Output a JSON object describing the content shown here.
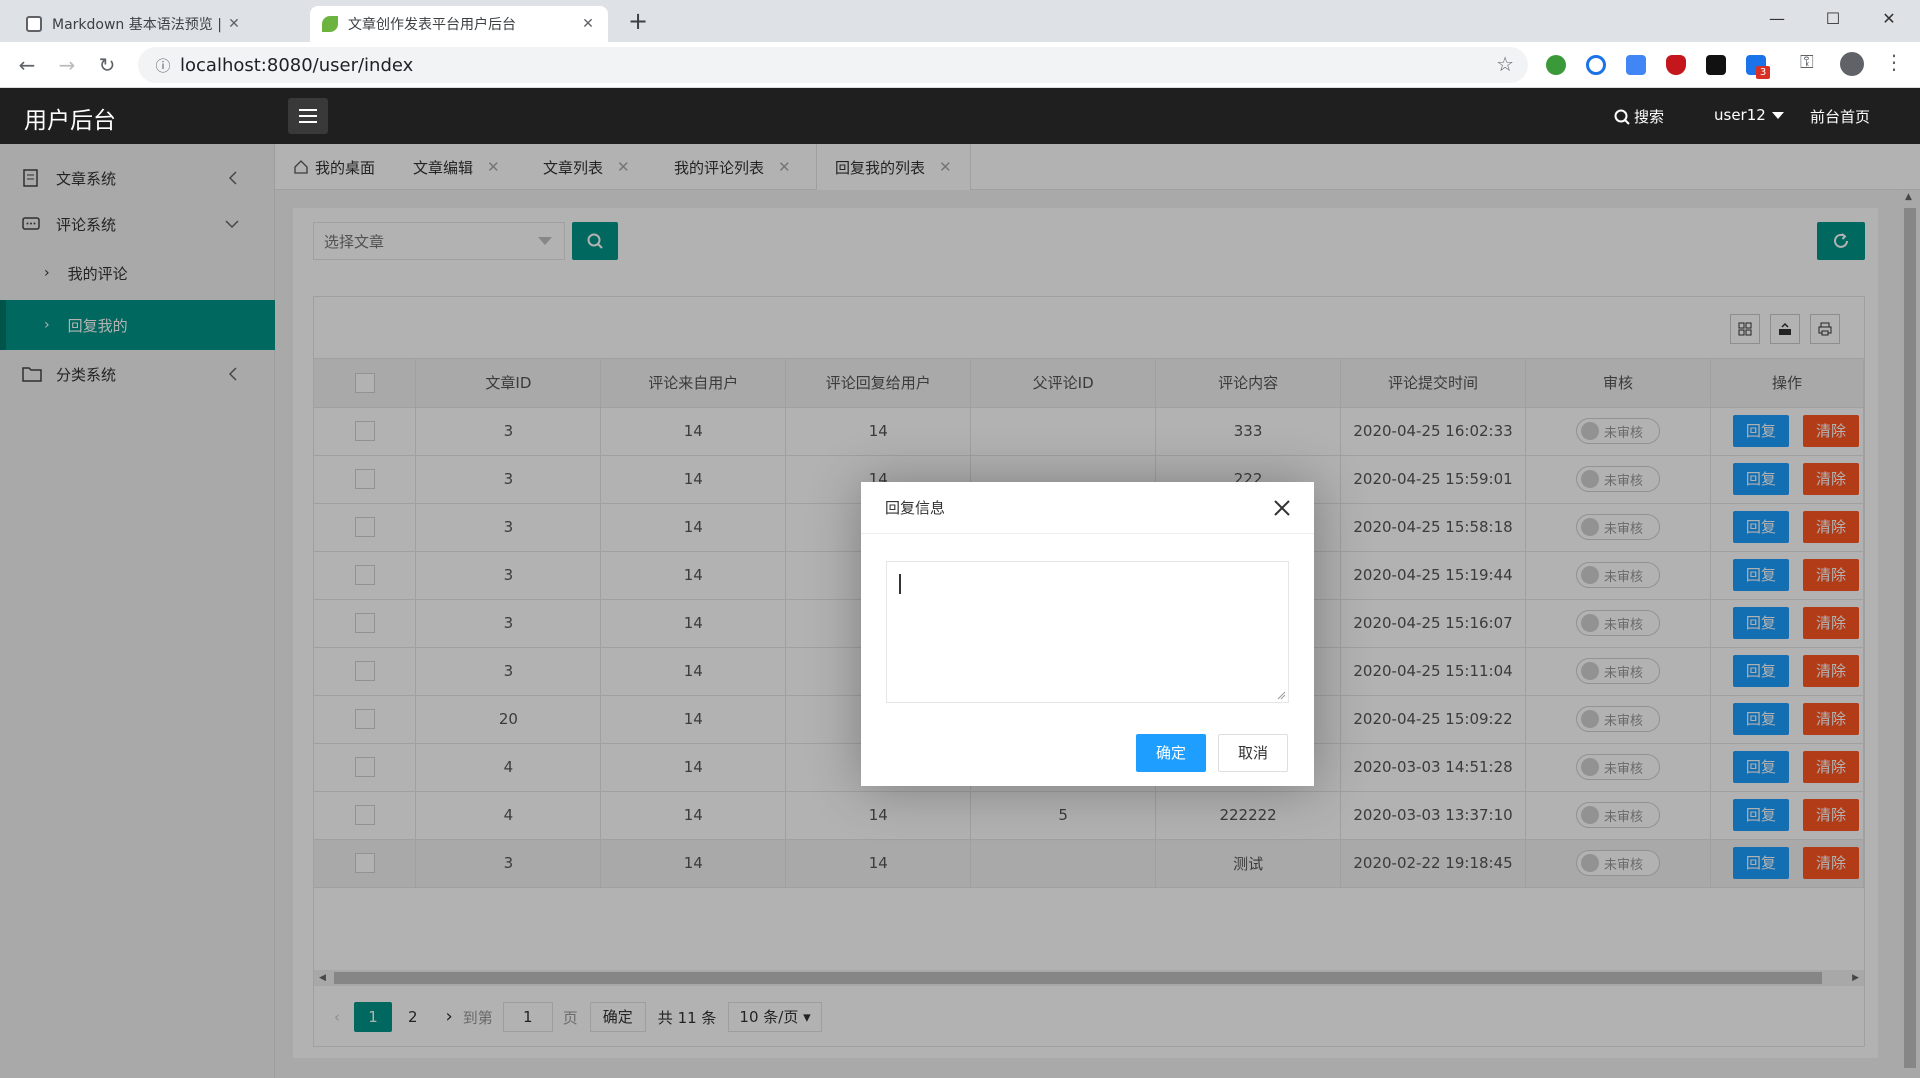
{
  "browser": {
    "tabs": [
      {
        "title": "Markdown 基本语法预览 | Yzb'",
        "close": "✕"
      },
      {
        "title": "文章创作发表平台用户后台",
        "close": "✕"
      }
    ],
    "new_tab": "+",
    "url": "localhost:8080/user/index",
    "ext_badge": "3",
    "window": {
      "minimize": "—",
      "maximize": "☐",
      "close": "✕"
    }
  },
  "header": {
    "logo": "用户后台",
    "search": "搜索",
    "user": "user12",
    "home": "前台首页"
  },
  "sidebar": {
    "items": [
      {
        "label": "文章系统"
      },
      {
        "label": "评论系统"
      },
      {
        "label": "我的评论"
      },
      {
        "label": "回复我的"
      },
      {
        "label": "分类系统"
      }
    ]
  },
  "page_tabs": [
    {
      "label": "我的桌面"
    },
    {
      "label": "文章编辑"
    },
    {
      "label": "文章列表"
    },
    {
      "label": "我的评论列表"
    },
    {
      "label": "回复我的列表"
    }
  ],
  "filter": {
    "select_placeholder": "选择文章"
  },
  "table": {
    "columns": [
      "文章ID",
      "评论来自用户",
      "评论回复给用户",
      "父评论ID",
      "评论内容",
      "评论提交时间",
      "审核",
      "操作"
    ],
    "rows": [
      {
        "article_id": "3",
        "from_user": "14",
        "to_user": "14",
        "parent_id": "",
        "content": "333",
        "time": "2020-04-25 16:02:33",
        "status": "未审核"
      },
      {
        "article_id": "3",
        "from_user": "14",
        "to_user": "14",
        "parent_id": "",
        "content": "222",
        "time": "2020-04-25 15:59:01",
        "status": "未审核"
      },
      {
        "article_id": "3",
        "from_user": "14",
        "to_user": "",
        "parent_id": "",
        "content": "",
        "time": "2020-04-25 15:58:18",
        "status": "未审核"
      },
      {
        "article_id": "3",
        "from_user": "14",
        "to_user": "",
        "parent_id": "",
        "content": "",
        "time": "2020-04-25 15:19:44",
        "status": "未审核"
      },
      {
        "article_id": "3",
        "from_user": "14",
        "to_user": "",
        "parent_id": "",
        "content": "",
        "time": "2020-04-25 15:16:07",
        "status": "未审核"
      },
      {
        "article_id": "3",
        "from_user": "14",
        "to_user": "",
        "parent_id": "",
        "content": "",
        "time": "2020-04-25 15:11:04",
        "status": "未审核"
      },
      {
        "article_id": "20",
        "from_user": "14",
        "to_user": "",
        "parent_id": "",
        "content": "",
        "time": "2020-04-25 15:09:22",
        "status": "未审核"
      },
      {
        "article_id": "4",
        "from_user": "14",
        "to_user": "",
        "parent_id": "",
        "content": "",
        "time": "2020-03-03 14:51:28",
        "status": "未审核"
      },
      {
        "article_id": "4",
        "from_user": "14",
        "to_user": "14",
        "parent_id": "5",
        "content": "222222",
        "time": "2020-03-03 13:37:10",
        "status": "未审核"
      },
      {
        "article_id": "3",
        "from_user": "14",
        "to_user": "14",
        "parent_id": "",
        "content": "测试",
        "time": "2020-02-22 19:18:45",
        "status": "未审核"
      }
    ],
    "reply_label": "回复",
    "delete_label": "清除"
  },
  "pager": {
    "pages": [
      "1",
      "2"
    ],
    "goto_label": "到第",
    "goto_value": "1",
    "page_unit": "页",
    "confirm": "确定",
    "total": "共 11 条",
    "page_size": "10 条/页"
  },
  "dialog": {
    "title": "回复信息",
    "ok": "确定",
    "cancel": "取消"
  },
  "colors": {
    "primary": "#009688",
    "blue": "#1e9fff",
    "red": "#ff5722"
  }
}
